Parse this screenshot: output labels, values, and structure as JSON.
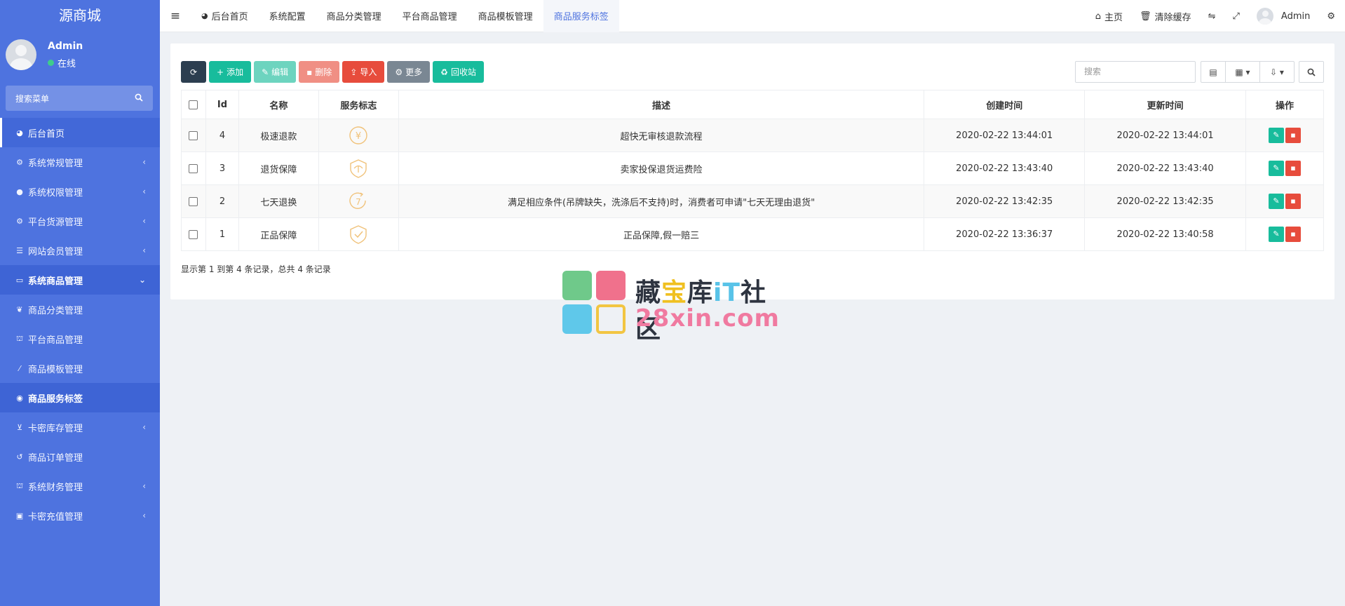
{
  "sidebar": {
    "brand": "源商城",
    "user": {
      "name": "Admin",
      "status": "在线"
    },
    "search_placeholder": "搜索菜单",
    "items": [
      {
        "label": "后台首页",
        "icon": "dashboard-icon",
        "state": "active"
      },
      {
        "label": "系统常规管理",
        "icon": "cogs-icon",
        "has_children": true
      },
      {
        "label": "系统权限管理",
        "icon": "users-icon",
        "has_children": true
      },
      {
        "label": "平台货源管理",
        "icon": "cogs-icon",
        "has_children": true
      },
      {
        "label": "网站会员管理",
        "icon": "list-icon",
        "has_children": true
      },
      {
        "label": "系统商品管理",
        "icon": "box-icon",
        "state": "open"
      },
      {
        "label": "商品分类管理",
        "icon": "leaf-icon"
      },
      {
        "label": "平台商品管理",
        "icon": "binoculars-icon"
      },
      {
        "label": "商品模板管理",
        "icon": "wand-icon"
      },
      {
        "label": "商品服务标签",
        "icon": "compass-icon",
        "state": "current"
      },
      {
        "label": "卡密库存管理",
        "icon": "cart-icon",
        "has_children": true
      },
      {
        "label": "商品订单管理",
        "icon": "history-icon"
      },
      {
        "label": "系统财务管理",
        "icon": "binoculars-icon",
        "has_children": true
      },
      {
        "label": "卡密充值管理",
        "icon": "money-icon",
        "has_children": true
      }
    ]
  },
  "topnav": {
    "tabs": [
      {
        "label": "后台首页",
        "icon": "dashboard-icon"
      },
      {
        "label": "系统配置"
      },
      {
        "label": "商品分类管理"
      },
      {
        "label": "平台商品管理"
      },
      {
        "label": "商品模板管理"
      },
      {
        "label": "商品服务标签",
        "active": true
      }
    ],
    "home_label": "主页",
    "clear_cache_label": "清除缓存",
    "user_label": "Admin"
  },
  "toolbar": {
    "add_label": "添加",
    "edit_label": "编辑",
    "delete_label": "删除",
    "import_label": "导入",
    "more_label": "更多",
    "recycle_label": "回收站",
    "search_placeholder": "搜索"
  },
  "table": {
    "headers": [
      "",
      "Id",
      "名称",
      "服务标志",
      "描述",
      "创建时间",
      "更新时间",
      "操作"
    ],
    "rows": [
      {
        "id": "4",
        "name": "极速退款",
        "icon": "yen-circle-icon",
        "desc": "超快无审核退款流程",
        "created": "2020-02-22 13:44:01",
        "updated": "2020-02-22 13:44:01"
      },
      {
        "id": "3",
        "name": "退货保障",
        "icon": "umbrella-shield-icon",
        "desc": "卖家投保退货运费险",
        "created": "2020-02-22 13:43:40",
        "updated": "2020-02-22 13:43:40"
      },
      {
        "id": "2",
        "name": "七天退换",
        "icon": "seven-day-icon",
        "desc": "满足相应条件(吊牌缺失，洗涤后不支持)时，消费者可申请\"七天无理由退货\"",
        "created": "2020-02-22 13:42:35",
        "updated": "2020-02-22 13:42:35"
      },
      {
        "id": "1",
        "name": "正品保障",
        "icon": "check-shield-icon",
        "desc": "正品保障,假一赔三",
        "created": "2020-02-22 13:36:37",
        "updated": "2020-02-22 13:40:58"
      }
    ]
  },
  "pager": {
    "summary": "显示第 1 到第 4 条记录，总共 4 条记录"
  },
  "watermark": {
    "line1_a": "藏",
    "line1_b": "宝",
    "line1_c": "库",
    "line1_d": "iT",
    "line1_e": "社区",
    "line2": "28xin.com"
  },
  "colors": {
    "sidebar": "#4e73df",
    "accent": "#18bc9c",
    "danger": "#e74c3c",
    "dark": "#2c3e50",
    "icon_gold": "#f0c27a"
  }
}
